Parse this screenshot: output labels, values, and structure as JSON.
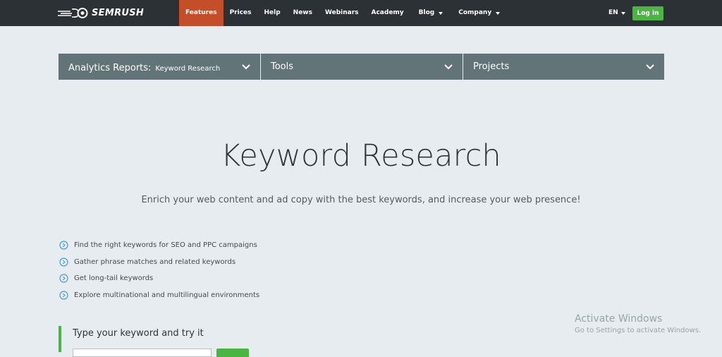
{
  "brand": {
    "name": "SEMRUSH"
  },
  "nav": {
    "items": [
      {
        "label": "Features",
        "active": true,
        "dropdown": false
      },
      {
        "label": "Prices",
        "active": false,
        "dropdown": false
      },
      {
        "label": "Help",
        "active": false,
        "dropdown": false
      },
      {
        "label": "News",
        "active": false,
        "dropdown": false
      },
      {
        "label": "Webinars",
        "active": false,
        "dropdown": false
      },
      {
        "label": "Academy",
        "active": false,
        "dropdown": false
      },
      {
        "label": "Blog",
        "active": false,
        "dropdown": true
      },
      {
        "label": "Company",
        "active": false,
        "dropdown": true
      }
    ],
    "language": "EN",
    "login_label": "Log in"
  },
  "categories": [
    {
      "label": "Analytics Reports:",
      "sub": "Keyword Research"
    },
    {
      "label": "Tools",
      "sub": ""
    },
    {
      "label": "Projects",
      "sub": ""
    }
  ],
  "hero": {
    "title": "Keyword Research",
    "subtitle": "Enrich your web content and ad copy with the best keywords, and increase your web presence!"
  },
  "features": [
    "Find the right keywords for SEO and PPC campaigns",
    "Gather phrase matches and related keywords",
    "Get long-tail keywords",
    "Explore multinational and multilingual environments"
  ],
  "try": {
    "label": "Type your keyword and try it",
    "input_value": ""
  },
  "watermark": {
    "title": "Activate Windows",
    "subtitle": "Go to Settings to activate Windows."
  },
  "colors": {
    "topbar": "#2c3135",
    "active_nav": "#c44d2a",
    "accent_green": "#4bb543",
    "category_bar": "#627477",
    "page_bg": "#e6ecf0"
  }
}
